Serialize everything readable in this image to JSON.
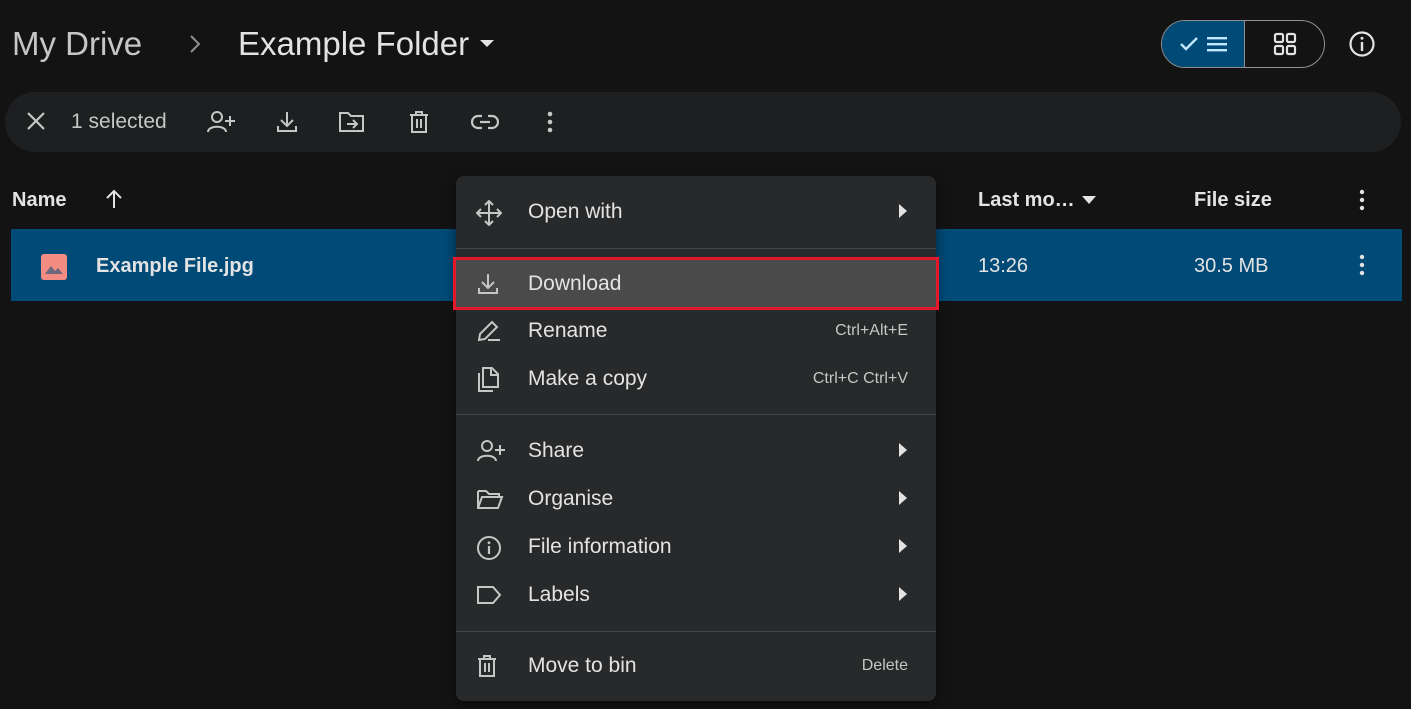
{
  "breadcrumb": {
    "root": "My Drive",
    "current": "Example Folder"
  },
  "selection_bar": {
    "count_label": "1 selected",
    "actions": [
      "close-icon",
      "share-icon",
      "download-icon",
      "move-icon",
      "trash-icon",
      "link-icon",
      "more-vert-icon"
    ]
  },
  "columns": {
    "name": "Name",
    "last_modified": "Last mo…",
    "file_size": "File size"
  },
  "file_row": {
    "name": "Example File.jpg",
    "modified": "13:26",
    "size": "30.5 MB"
  },
  "context_menu": {
    "items": [
      {
        "label": "Open with",
        "icon": "open-with-icon",
        "submenu": true
      },
      {
        "label": "Download",
        "icon": "download-icon",
        "highlighted": true
      },
      {
        "label": "Rename",
        "icon": "rename-icon",
        "shortcut": "Ctrl+Alt+E"
      },
      {
        "label": "Make a copy",
        "icon": "copy-icon",
        "shortcut": "Ctrl+C Ctrl+V"
      },
      {
        "label": "Share",
        "icon": "share-icon",
        "submenu": true
      },
      {
        "label": "Organise",
        "icon": "folder-open-icon",
        "submenu": true
      },
      {
        "label": "File information",
        "icon": "info-icon",
        "submenu": true
      },
      {
        "label": "Labels",
        "icon": "label-icon",
        "submenu": true
      },
      {
        "label": "Move to bin",
        "icon": "trash-icon",
        "shortcut": "Delete"
      }
    ]
  },
  "colors": {
    "background": "#131314",
    "selection": "#004a77",
    "menu": "#28292a",
    "highlight_border": "#e3192b",
    "image_icon": "#f28b82"
  }
}
